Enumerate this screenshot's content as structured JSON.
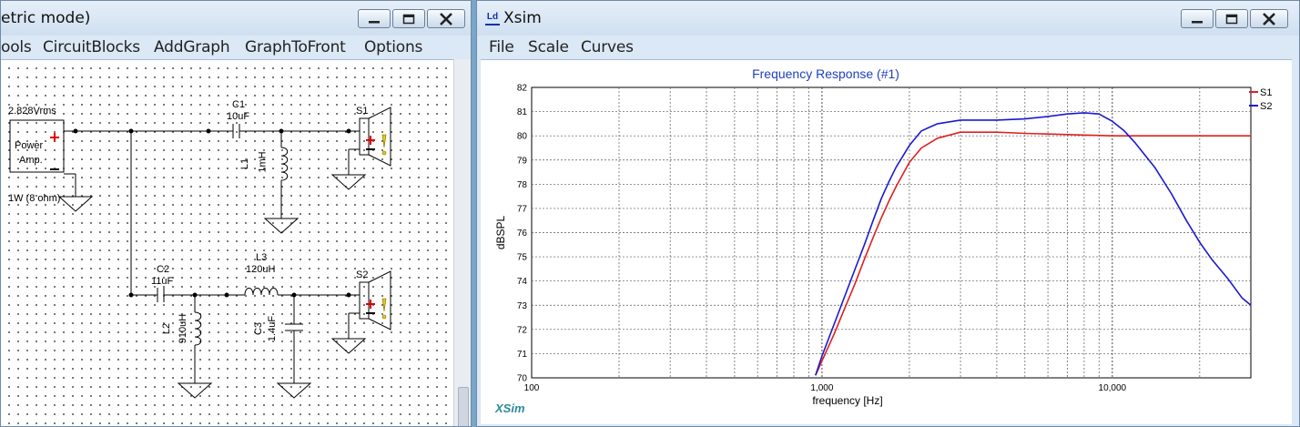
{
  "left_window": {
    "title": "etric mode)",
    "menu": [
      "ools",
      "CircuitBlocks",
      "AddGraph",
      "GraphToFront",
      "Options"
    ],
    "circuit": {
      "source_voltage": "2.828Vrms",
      "source_name_line1": "Power",
      "source_name_line2": "Amp.",
      "source_power": "1W (8 ohm)",
      "c1_name": "C1",
      "c1_value": "10uF",
      "l1_name": "L1",
      "l1_value": "1mH",
      "s1_name": "S1",
      "c2_name": "C2",
      "c2_value": "11uF",
      "l3_name": "L3",
      "l3_value": "120uH",
      "l2_name": "L2",
      "l2_value": "910uH",
      "c3_name": "C3",
      "c3_value": "1.4uF",
      "s2_name": "S2"
    }
  },
  "right_window": {
    "title": "Xsim",
    "app_icon_glyph": "Ld",
    "menu": [
      "File",
      "Scale",
      "Curves"
    ],
    "watermark": "XSim"
  },
  "colors": {
    "s1": "#e02020",
    "s2": "#1a1ad0",
    "title": "#2040c0",
    "watermark": "#2a8a9a"
  },
  "chart_data": {
    "type": "line",
    "title": "Frequency Response (#1)",
    "xlabel": "frequency [Hz]",
    "ylabel": "dBSPL",
    "xscale": "log",
    "xlim": [
      100,
      30000
    ],
    "ylim": [
      70,
      82
    ],
    "xticks": [
      100,
      1000,
      10000
    ],
    "xtick_labels": [
      "100",
      "1,000",
      "10,000"
    ],
    "yticks": [
      70,
      71,
      72,
      73,
      74,
      75,
      76,
      77,
      78,
      79,
      80,
      81,
      82
    ],
    "grid": true,
    "legend": "top-right",
    "series": [
      {
        "name": "S1",
        "color": "#e02020",
        "x": [
          950,
          1000,
          1100,
          1200,
          1300,
          1400,
          1500,
          1600,
          1700,
          1800,
          2000,
          2200,
          2500,
          3000,
          4000,
          5000,
          7000,
          10000,
          20000,
          30000
        ],
        "y": [
          70.1,
          70.7,
          71.8,
          72.9,
          73.9,
          74.9,
          75.8,
          76.6,
          77.3,
          77.9,
          78.9,
          79.5,
          79.9,
          80.15,
          80.15,
          80.1,
          80.05,
          80.0,
          80.0,
          80.0
        ]
      },
      {
        "name": "S2",
        "color": "#1a1ad0",
        "x": [
          950,
          1000,
          1100,
          1200,
          1300,
          1400,
          1500,
          1600,
          1700,
          1800,
          2000,
          2200,
          2500,
          3000,
          4000,
          5000,
          6000,
          7000,
          8000,
          9000,
          10000,
          11000,
          12000,
          14000,
          16000,
          18000,
          20000,
          22000,
          25000,
          28000,
          30000
        ],
        "y": [
          70.1,
          70.9,
          72.2,
          73.4,
          74.5,
          75.5,
          76.5,
          77.4,
          78.1,
          78.7,
          79.6,
          80.2,
          80.5,
          80.65,
          80.65,
          80.7,
          80.8,
          80.9,
          80.95,
          80.9,
          80.6,
          80.2,
          79.7,
          78.7,
          77.6,
          76.5,
          75.6,
          74.9,
          74.1,
          73.3,
          73.0
        ]
      }
    ]
  }
}
